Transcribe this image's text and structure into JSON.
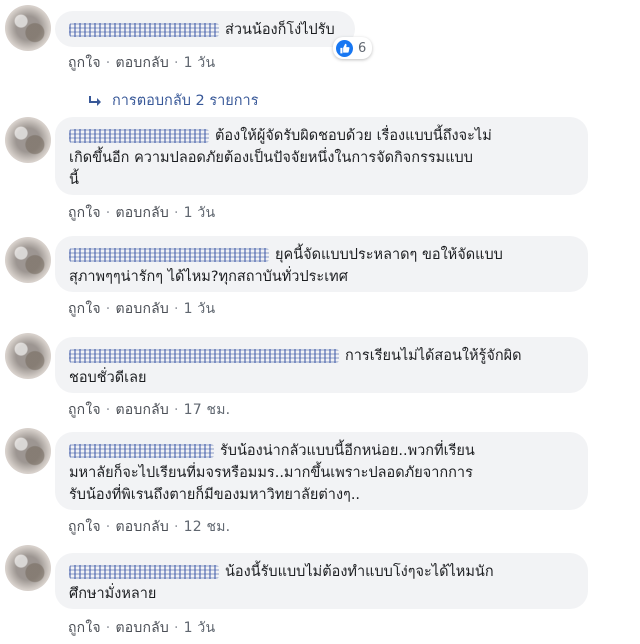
{
  "comments": [
    {
      "text": "ส่วนน้องก็โง่ไปรับ",
      "like_label": "ถูกใจ",
      "reply_label": "ตอบกลับ",
      "time": "1 วัน",
      "reaction_count": "6"
    },
    {
      "text": "ต้องให้ผู้จัดรับผิดชอบด้วย เรื่องแบบนี้ถึงจะไม่",
      "text2": "เกิดขึ้นอีก ความปลอดภัยต้องเป็นปัจจัยหนึ่งในการจัดกิจกรรมแบบ",
      "text3": "นี้",
      "like_label": "ถูกใจ",
      "reply_label": "ตอบกลับ",
      "time": "1 วัน"
    },
    {
      "text": "ยุคนี้จัดแบบประหลาดๆ ขอให้จัดแบบ",
      "text2": "สุภาพๆๆน่ารักๆ ได้ไหม?ทุกสถาบันทั่วประเทศ",
      "like_label": "ถูกใจ",
      "reply_label": "ตอบกลับ",
      "time": "1 วัน"
    },
    {
      "text": "การเรียนไม่ได้สอนให้รู้จักผิด",
      "text2": "ชอบชั่วดีเลย",
      "like_label": "ถูกใจ",
      "reply_label": "ตอบกลับ",
      "time": "17 ชม."
    },
    {
      "text": "รับน้องน่ากลัวแบบนี้อีกหน่อย..พวกที่เรียน",
      "text2": "มหาลัยก็จะไปเรียนที่มจรหรือมมร..มากขึ้นเพราะปลอดภัยจากการ",
      "text3": "รับน้องที่พิเรนถึงตายก็มีของมหาวิทยาลัยต่างๆ..",
      "like_label": "ถูกใจ",
      "reply_label": "ตอบกลับ",
      "time": "12 ชม."
    },
    {
      "text": "น้องนี้รับแบบไม่ต้องทำแบบโง่ๆจะได้ไหมนัก",
      "text2": "ศึกษามั่งหลาย",
      "like_label": "ถูกใจ",
      "reply_label": "ตอบกลับ",
      "time": "1 วัน"
    }
  ],
  "replies_link": "การตอบกลับ 2 รายการ",
  "colors": {
    "bubble": "#f2f3f5",
    "link": "#385898",
    "like": "#1877f2"
  }
}
